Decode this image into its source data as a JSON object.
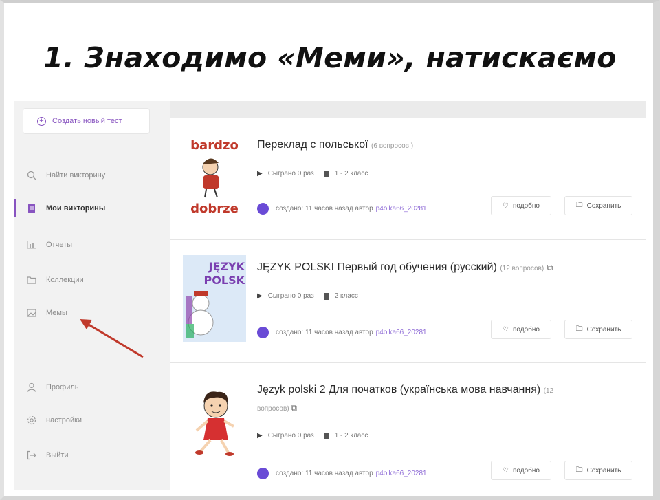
{
  "slide_title": "1. Знаходимо «Меми», натискаємо",
  "sidebar": {
    "create_button": "Создать новый тест",
    "items": [
      {
        "label": "Найти викторину",
        "icon": "search-icon"
      },
      {
        "label": "Мои викторины",
        "icon": "document-icon",
        "active": true
      },
      {
        "label": "Отчеты",
        "icon": "chart-icon"
      },
      {
        "label": "Коллекции",
        "icon": "folder-icon"
      },
      {
        "label": "Мемы",
        "icon": "image-icon"
      },
      {
        "label": "Профиль",
        "icon": "user-icon"
      },
      {
        "label": "настройки",
        "icon": "gear-icon"
      },
      {
        "label": "Выйти",
        "icon": "logout-icon"
      }
    ]
  },
  "quizzes": [
    {
      "title": "Переклад с польської",
      "count": "(6 вопросов )",
      "played": "Сыграно 0 раз",
      "grade": "1 - 2 класс",
      "created": "создано: 11 часов назад автор",
      "author": "p4olka66_20281",
      "like": "подобно",
      "save": "Сохранить",
      "thumb_top": "bardzo",
      "thumb_bottom": "dobrze"
    },
    {
      "title": "JĘZYK POLSKI Первый год обучения (русский)",
      "count": "(12 вопросов)",
      "played": "Сыграно 0 раз",
      "grade": "2 класс",
      "created": "создано: 11 часов назад автор",
      "author": "p4olka66_20281",
      "like": "подобно",
      "save": "Сохранить",
      "thumb_top": "JĘZYK",
      "thumb_bottom": "POLSK"
    },
    {
      "title": "Język polski 2 Для початков (українська мова навчання)",
      "count": "(12",
      "count2": "вопросов)",
      "played": "Сыграно 0 раз",
      "grade": "1 - 2 класс",
      "created": "создано: 11 часов назад автор",
      "author": "p4olka66_20281",
      "like": "подобно",
      "save": "Сохранить"
    }
  ],
  "colors": {
    "accent": "#8854c0",
    "arrow": "#c0392b"
  }
}
